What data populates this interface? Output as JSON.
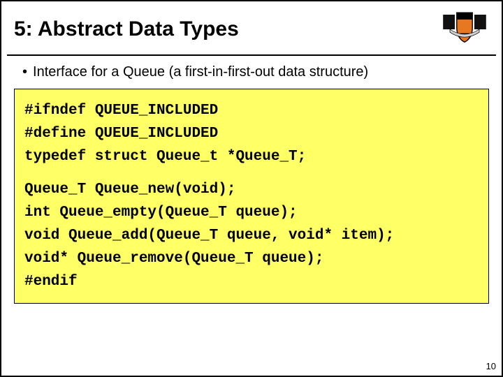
{
  "title": "5: Abstract Data Types",
  "bullet": "Interface for a Queue (a first-in-first-out data structure)",
  "code": {
    "l1": "#ifndef QUEUE_INCLUDED",
    "l2": "#define QUEUE_INCLUDED",
    "l3": "typedef struct Queue_t *Queue_T;",
    "l4": "Queue_T Queue_new(void);",
    "l5": "int Queue_empty(Queue_T queue);",
    "l6": "void Queue_add(Queue_T queue, void* item);",
    "l7": "void* Queue_remove(Queue_T queue);",
    "l8": "#endif"
  },
  "page_number": "10"
}
